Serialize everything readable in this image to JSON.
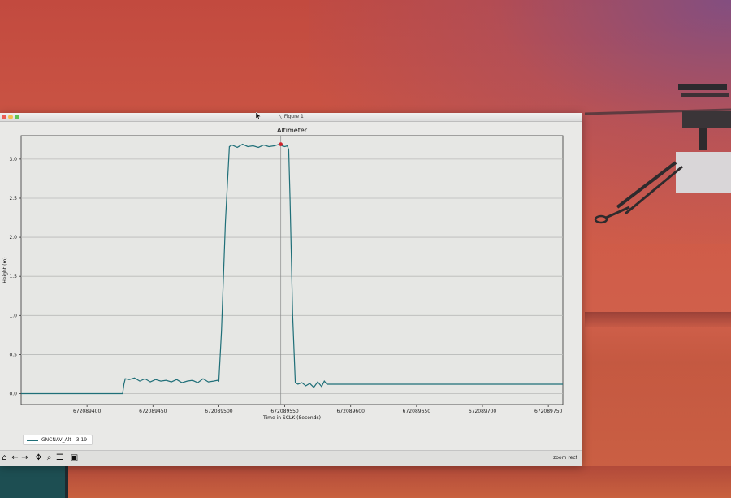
{
  "window": {
    "title": "Figure 1",
    "status": "zoom rect"
  },
  "toolbar": {
    "icons": [
      "home-icon",
      "back-icon",
      "forward-icon",
      "pan-icon",
      "zoom-icon",
      "configure-icon",
      "save-icon"
    ]
  },
  "colors": {
    "line": "#1f6f78",
    "marker": "#d0212b",
    "crosshair": "#8a8a8a"
  },
  "chart_data": {
    "type": "line",
    "title": "Altimeter",
    "xlabel": "Time in SCLK (Seconds)",
    "ylabel": "Height (m)",
    "xlim": [
      672089350,
      672089761
    ],
    "ylim": [
      -0.14,
      3.3
    ],
    "xticks": [
      672089400,
      672089450,
      672089500,
      672089550,
      672089600,
      672089650,
      672089700,
      672089750
    ],
    "yticks": [
      0.0,
      0.5,
      1.0,
      1.5,
      2.0,
      2.5,
      3.0
    ],
    "grid": true,
    "legend_position": "lower-left",
    "series": [
      {
        "name": "GNCNAV_Alt - 3.19",
        "x": [
          672089350,
          672089427,
          672089428,
          672089429,
          672089432,
          672089436,
          672089440,
          672089444,
          672089448,
          672089452,
          672089456,
          672089460,
          672089464,
          672089468,
          672089472,
          672089476,
          672089480,
          672089484,
          672089488,
          672089492,
          672089496,
          672089499,
          672089500,
          672089502,
          672089505,
          672089508,
          672089510,
          672089514,
          672089518,
          672089522,
          672089526,
          672089530,
          672089534,
          672089538,
          672089542,
          672089544,
          672089546,
          672089548,
          672089550,
          672089552,
          672089553,
          672089554,
          672089556,
          672089558,
          672089560,
          672089563,
          672089566,
          672089569,
          672089572,
          672089575,
          672089578,
          672089580,
          672089582,
          672089761
        ],
        "y": [
          0.0,
          0.0,
          0.12,
          0.19,
          0.18,
          0.2,
          0.16,
          0.19,
          0.15,
          0.18,
          0.16,
          0.17,
          0.15,
          0.18,
          0.14,
          0.16,
          0.17,
          0.14,
          0.19,
          0.15,
          0.16,
          0.17,
          0.16,
          0.8,
          2.2,
          3.16,
          3.18,
          3.15,
          3.19,
          3.16,
          3.17,
          3.15,
          3.18,
          3.16,
          3.17,
          3.18,
          3.19,
          3.17,
          3.16,
          3.17,
          3.12,
          2.5,
          1.0,
          0.14,
          0.12,
          0.14,
          0.1,
          0.13,
          0.08,
          0.15,
          0.09,
          0.16,
          0.12,
          0.12
        ]
      }
    ],
    "highlight": {
      "x": 672089547,
      "y": 3.19
    }
  }
}
